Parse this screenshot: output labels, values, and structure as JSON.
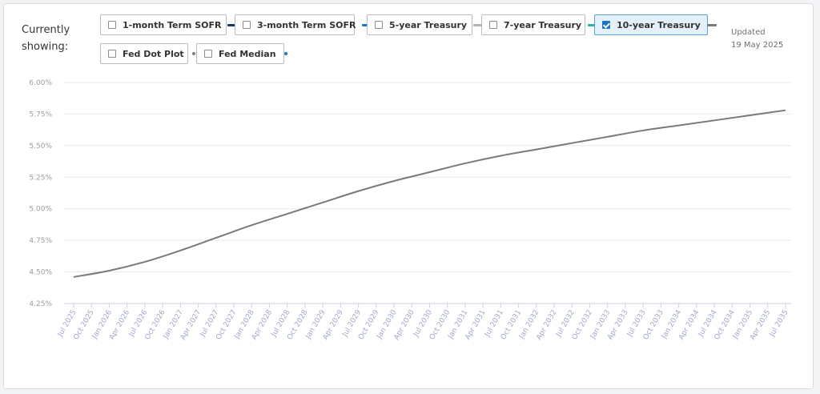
{
  "header": {
    "showing_label": "Currently showing:",
    "updated_label": "Updated",
    "updated_date": "19 May 2025"
  },
  "filters": [
    {
      "label": "1-month Term SOFR",
      "checked": false,
      "marker": "line",
      "color": "#123a5e"
    },
    {
      "label": "3-month Term SOFR",
      "checked": false,
      "marker": "line",
      "color": "#1a78c2"
    },
    {
      "label": "5-year Treasury",
      "checked": false,
      "marker": "line",
      "color": "#b3b3b3"
    },
    {
      "label": "7-year Treasury",
      "checked": false,
      "marker": "line",
      "color": "#21b5a5"
    },
    {
      "label": "10-year Treasury",
      "checked": true,
      "marker": "line",
      "color": "#7a7a7a"
    },
    {
      "label": "Fed Dot Plot",
      "checked": false,
      "marker": "dot",
      "color": "#808080"
    },
    {
      "label": "Fed Median",
      "checked": false,
      "marker": "dot",
      "color": "#1a78c2"
    }
  ],
  "chart_data": {
    "type": "line",
    "ylim": [
      4.25,
      6.0
    ],
    "y_ticks": [
      "6.00%",
      "5.75%",
      "5.50%",
      "5.25%",
      "5.00%",
      "4.75%",
      "4.50%",
      "4.25%"
    ],
    "x_tick_labels": [
      "Jul 2025",
      "Oct 2025",
      "Jan 2026",
      "Apr 2026",
      "Jul 2026",
      "Oct 2026",
      "Jan 2027",
      "Apr 2027",
      "Jul 2027",
      "Oct 2027",
      "Jan 2028",
      "Apr 2028",
      "Jul 2028",
      "Oct 2028",
      "Jan 2029",
      "Apr 2029",
      "Jul 2029",
      "Oct 2029",
      "Jan 2030",
      "Apr 2030",
      "Jul 2030",
      "Oct 2030",
      "Jan 2031",
      "Apr 2031",
      "Jul 2031",
      "Oct 2031",
      "Jan 2032",
      "Apr 2032",
      "Jul 2032",
      "Oct 2032",
      "Jan 2033",
      "Apr 2033",
      "Jul 2033",
      "Oct 2033",
      "Jan 2034",
      "Apr 2034",
      "Jul 2034",
      "Oct 2034",
      "Jan 2035",
      "Apr 2035",
      "Jul 2035"
    ],
    "grid": true,
    "series": [
      {
        "color": "#7a7a7a",
        "x": [
          "Jul 2025",
          "Jan 2026",
          "Jul 2026",
          "Jan 2027",
          "Jul 2027",
          "Jan 2028",
          "Jul 2028",
          "Jan 2029",
          "Jul 2029",
          "Jan 2030",
          "Jul 2030",
          "Jan 2031",
          "Jul 2031",
          "Jan 2032",
          "Jul 2032",
          "Jan 2033",
          "Jul 2033",
          "Jan 2034",
          "Jul 2034",
          "Jan 2035",
          "Jul 2035"
        ],
        "values": [
          4.46,
          4.51,
          4.58,
          4.67,
          4.77,
          4.87,
          4.96,
          5.05,
          5.14,
          5.22,
          5.29,
          5.36,
          5.42,
          5.47,
          5.52,
          5.57,
          5.62,
          5.66,
          5.7,
          5.74,
          5.78
        ]
      }
    ]
  }
}
